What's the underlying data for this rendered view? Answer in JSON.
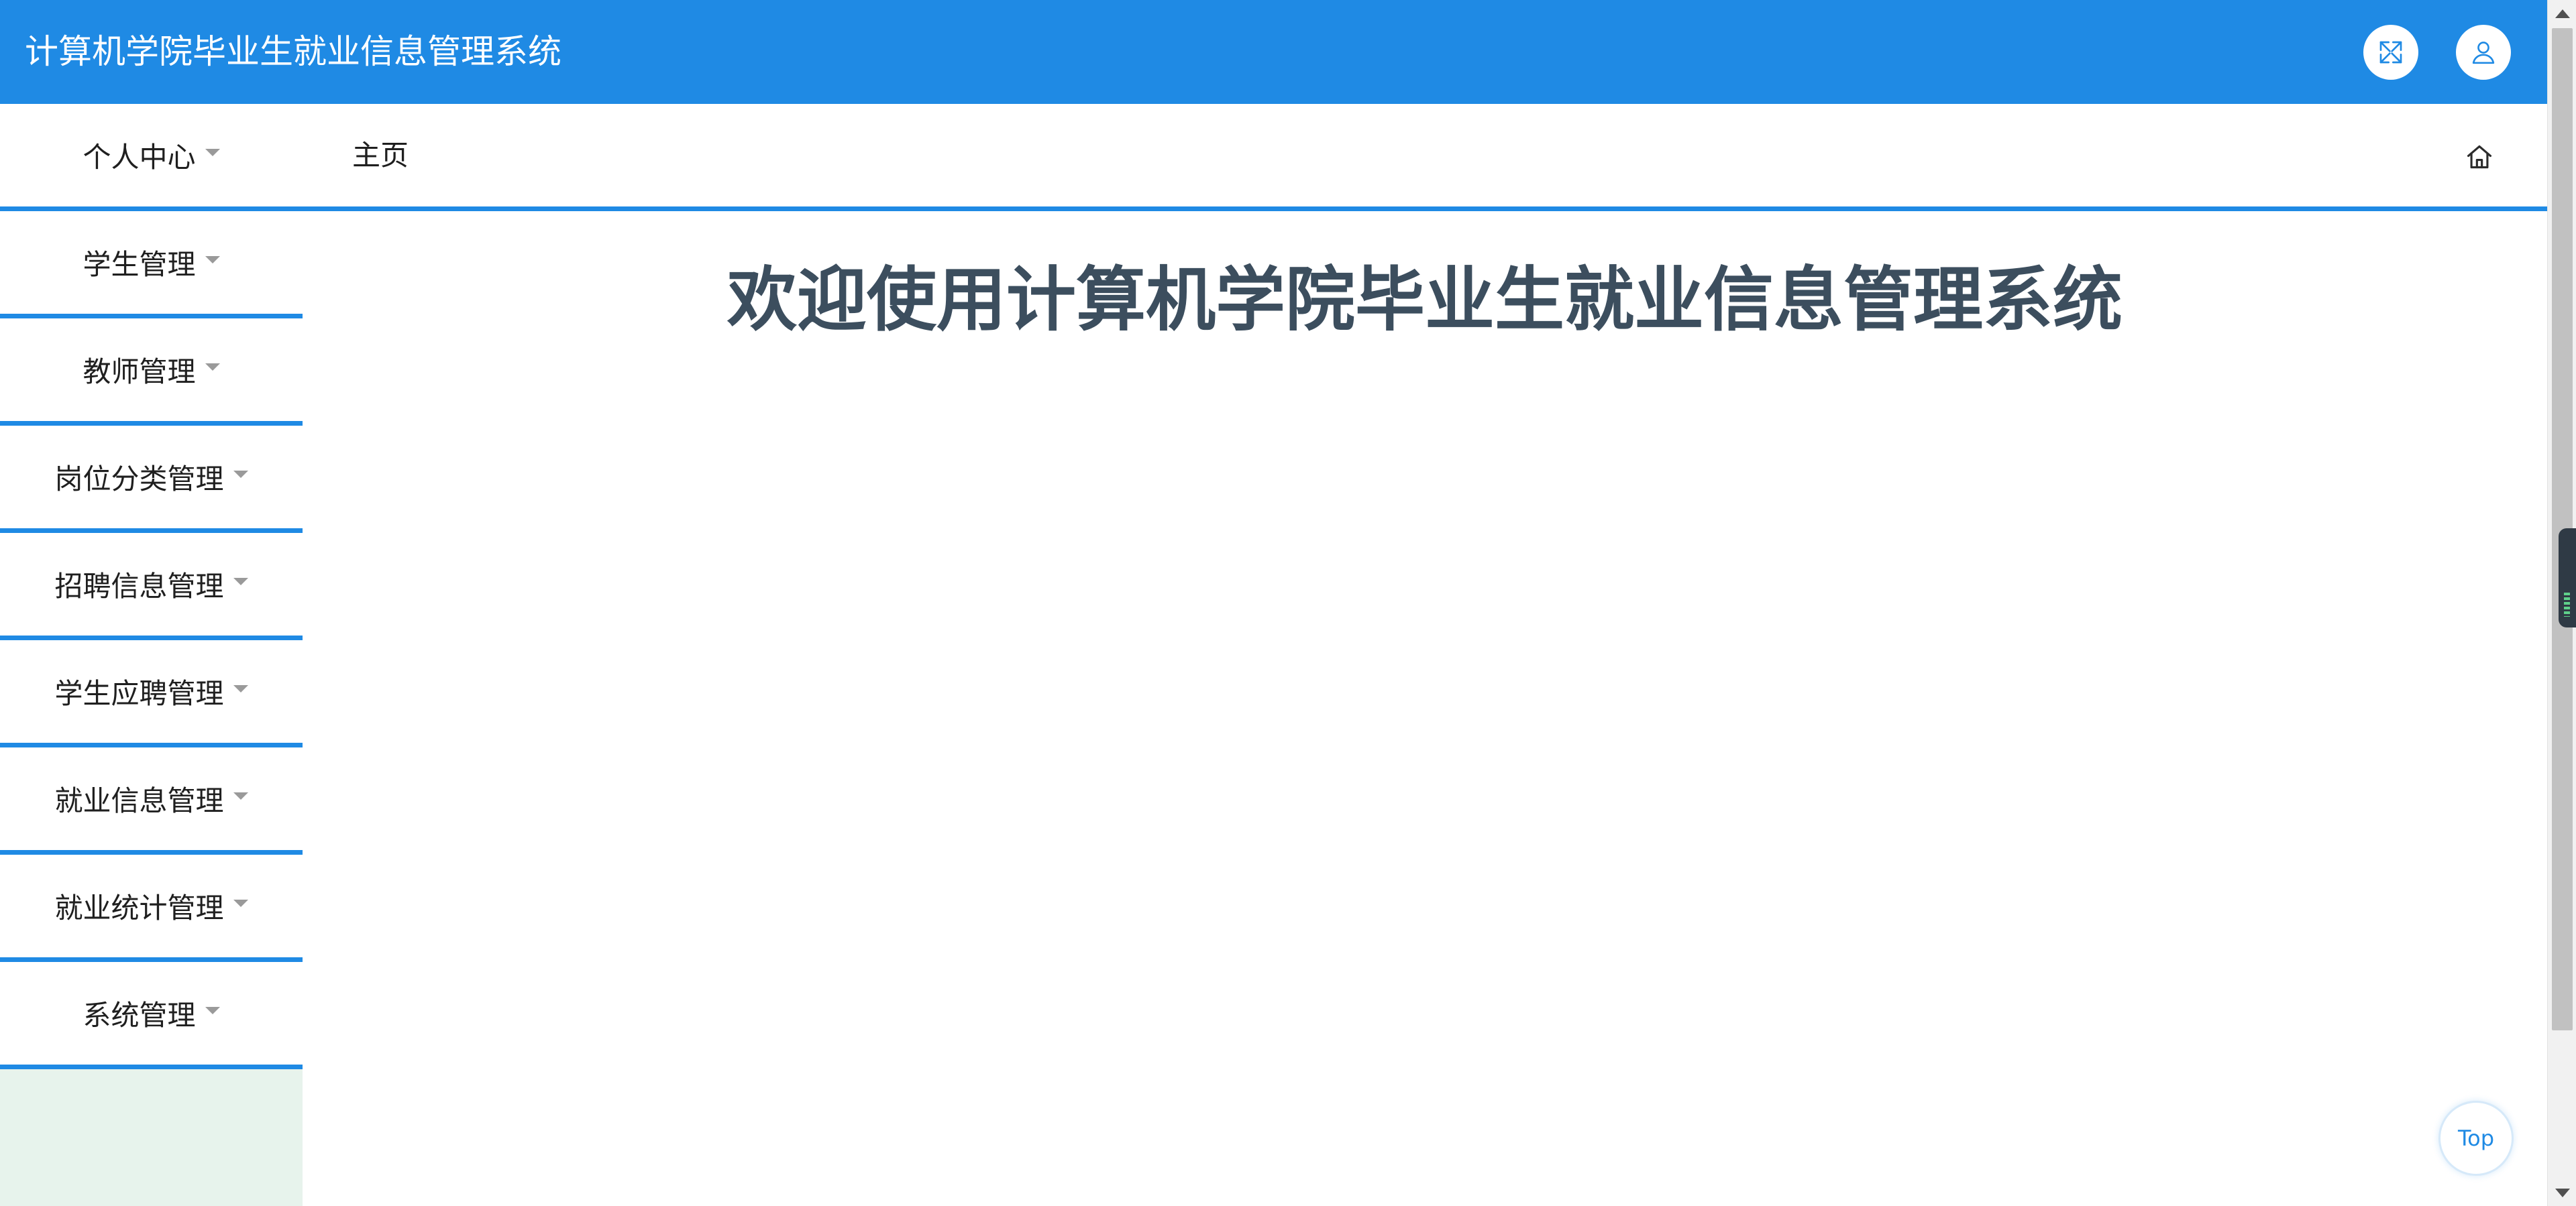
{
  "header": {
    "title": "计算机学院毕业生就业信息管理系统",
    "fullscreen_icon": "expand-icon",
    "user_icon": "user-icon",
    "color": "#1f8ae4"
  },
  "sidebar": {
    "items": [
      {
        "label": "个人中心",
        "icon": "caret-down-icon"
      },
      {
        "label": "学生管理",
        "icon": "caret-down-icon"
      },
      {
        "label": "教师管理",
        "icon": "caret-down-icon"
      },
      {
        "label": "岗位分类管理",
        "icon": "caret-down-icon"
      },
      {
        "label": "招聘信息管理",
        "icon": "caret-down-icon"
      },
      {
        "label": "学生应聘管理",
        "icon": "caret-down-icon"
      },
      {
        "label": "就业信息管理",
        "icon": "caret-down-icon"
      },
      {
        "label": "就业统计管理",
        "icon": "caret-down-icon"
      },
      {
        "label": "系统管理",
        "icon": "caret-down-icon"
      }
    ],
    "background": "#e7f3ec"
  },
  "tabbar": {
    "home_label": "主页",
    "home_icon": "home-icon"
  },
  "main": {
    "welcome": "欢迎使用计算机学院毕业生就业信息管理系统",
    "welcome_color": "#3c4e5e"
  },
  "back_to_top": {
    "label": "Top"
  },
  "colors": {
    "accent": "#1f8ae4",
    "text": "#1f1f1f"
  }
}
